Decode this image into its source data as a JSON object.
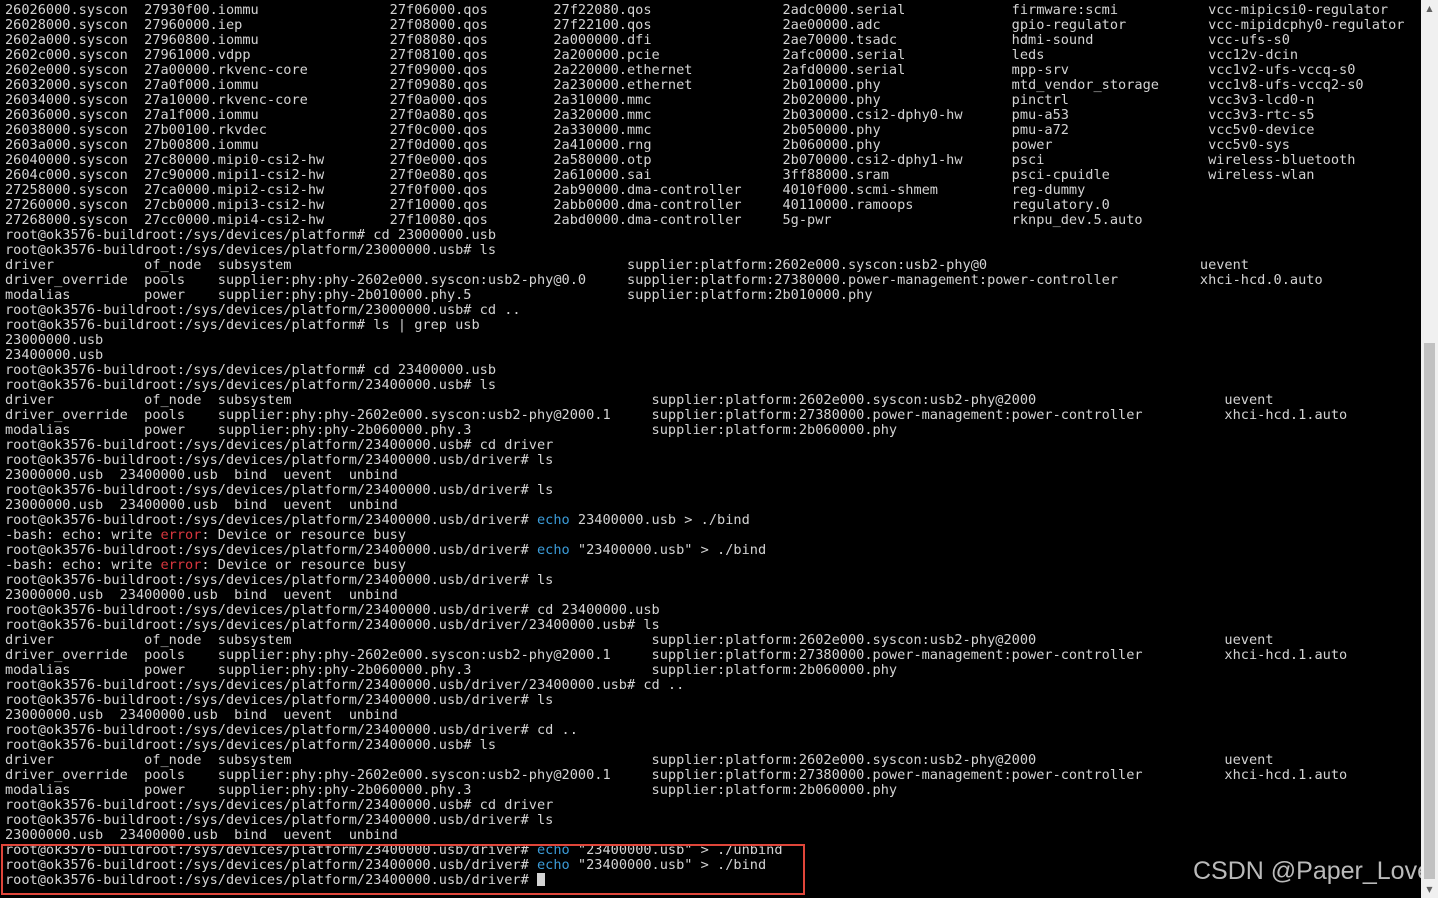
{
  "terminal": {
    "lines": [
      "26026000.syscon  27930f00.iommu                27f06000.qos        27f22080.qos                2adc0000.serial             firmware:scmi           vcc-mipicsi0-regulator",
      "26028000.syscon  27960000.iep                  27f08000.qos        27f22100.qos                2ae00000.adc                gpio-regulator          vcc-mipidcphy0-regulator",
      "2602a000.syscon  27960800.iommu                27f08080.qos        2a000000.dfi                2ae70000.tsadc              hdmi-sound              vcc-ufs-s0",
      "2602c000.syscon  27961000.vdpp                 27f08100.qos        2a200000.pcie               2afc0000.serial             leds                    vcc12v-dcin",
      "2602e000.syscon  27a00000.rkvenc-core          27f09000.qos        2a220000.ethernet           2afd0000.serial             mpp-srv                 vcc1v2-ufs-vccq-s0",
      "26032000.syscon  27a0f000.iommu                27f09080.qos        2a230000.ethernet           2b010000.phy                mtd_vendor_storage      vcc1v8-ufs-vccq2-s0",
      "26034000.syscon  27a10000.rkvenc-core          27f0a000.qos        2a310000.mmc                2b020000.phy                pinctrl                 vcc3v3-lcd0-n",
      "26036000.syscon  27a1f000.iommu                27f0a080.qos        2a320000.mmc                2b030000.csi2-dphy0-hw      pmu-a53                 vcc3v3-rtc-s5",
      "26038000.syscon  27b00100.rkvdec               27f0c000.qos        2a330000.mmc                2b050000.phy                pmu-a72                 vcc5v0-device",
      "2603a000.syscon  27b00800.iommu                27f0d000.qos        2a410000.rng                2b060000.phy                power                   vcc5v0-sys",
      "26040000.syscon  27c80000.mipi0-csi2-hw        27f0e000.qos        2a580000.otp                2b070000.csi2-dphy1-hw      psci                    wireless-bluetooth",
      "2604c000.syscon  27c90000.mipi1-csi2-hw        27f0e080.qos        2a610000.sai                3ff88000.sram               psci-cpuidle            wireless-wlan",
      "27258000.syscon  27ca0000.mipi2-csi2-hw        27f0f000.qos        2ab90000.dma-controller     4010f000.scmi-shmem         reg-dummy",
      "27260000.syscon  27cb0000.mipi3-csi2-hw        27f10000.qos        2abb0000.dma-controller     40110000.ramoops            regulatory.0",
      "27268000.syscon  27cc0000.mipi4-csi2-hw        27f10080.qos        2abd0000.dma-controller     5g-pwr                      rknpu_dev.5.auto",
      "root@ok3576-buildroot:/sys/devices/platform# cd 23000000.usb",
      "root@ok3576-buildroot:/sys/devices/platform/23000000.usb# ls",
      "driver           of_node  subsystem                                         supplier:platform:2602e000.syscon:usb2-phy@0                          uevent",
      "driver_override  pools    supplier:phy:phy-2602e000.syscon:usb2-phy@0.0     supplier:platform:27380000.power-management:power-controller          xhci-hcd.0.auto",
      "modalias         power    supplier:phy:phy-2b010000.phy.5                   supplier:platform:2b010000.phy",
      "root@ok3576-buildroot:/sys/devices/platform/23000000.usb# cd ..",
      "root@ok3576-buildroot:/sys/devices/platform# ls | grep usb",
      "23000000.usb",
      "23400000.usb",
      "root@ok3576-buildroot:/sys/devices/platform# cd 23400000.usb",
      "root@ok3576-buildroot:/sys/devices/platform/23400000.usb# ls",
      "driver           of_node  subsystem                                            supplier:platform:2602e000.syscon:usb2-phy@2000                       uevent",
      "driver_override  pools    supplier:phy:phy-2602e000.syscon:usb2-phy@2000.1     supplier:platform:27380000.power-management:power-controller          xhci-hcd.1.auto",
      "modalias         power    supplier:phy:phy-2b060000.phy.3                      supplier:platform:2b060000.phy",
      "root@ok3576-buildroot:/sys/devices/platform/23400000.usb# cd driver",
      "root@ok3576-buildroot:/sys/devices/platform/23400000.usb/driver# ls",
      "23000000.usb  23400000.usb  bind  uevent  unbind",
      "root@ok3576-buildroot:/sys/devices/platform/23400000.usb/driver# ls",
      "23000000.usb  23400000.usb  bind  uevent  unbind",
      "root@ok3576-buildroot:/sys/devices/platform/23400000.usb/driver# echo 23400000.usb > ./bind",
      "-bash: echo: write error: Device or resource busy",
      "root@ok3576-buildroot:/sys/devices/platform/23400000.usb/driver# echo \"23400000.usb\" > ./bind",
      "-bash: echo: write error: Device or resource busy",
      "root@ok3576-buildroot:/sys/devices/platform/23400000.usb/driver# ls",
      "23000000.usb  23400000.usb  bind  uevent  unbind",
      "root@ok3576-buildroot:/sys/devices/platform/23400000.usb/driver# cd 23400000.usb",
      "root@ok3576-buildroot:/sys/devices/platform/23400000.usb/driver/23400000.usb# ls",
      "driver           of_node  subsystem                                            supplier:platform:2602e000.syscon:usb2-phy@2000                       uevent",
      "driver_override  pools    supplier:phy:phy-2602e000.syscon:usb2-phy@2000.1     supplier:platform:27380000.power-management:power-controller          xhci-hcd.1.auto",
      "modalias         power    supplier:phy:phy-2b060000.phy.3                      supplier:platform:2b060000.phy",
      "root@ok3576-buildroot:/sys/devices/platform/23400000.usb/driver/23400000.usb# cd ..",
      "root@ok3576-buildroot:/sys/devices/platform/23400000.usb/driver# ls",
      "23000000.usb  23400000.usb  bind  uevent  unbind",
      "root@ok3576-buildroot:/sys/devices/platform/23400000.usb/driver# cd ..",
      "root@ok3576-buildroot:/sys/devices/platform/23400000.usb# ls",
      "driver           of_node  subsystem                                            supplier:platform:2602e000.syscon:usb2-phy@2000                       uevent",
      "driver_override  pools    supplier:phy:phy-2602e000.syscon:usb2-phy@2000.1     supplier:platform:27380000.power-management:power-controller          xhci-hcd.1.auto",
      "modalias         power    supplier:phy:phy-2b060000.phy.3                      supplier:platform:2b060000.phy",
      "root@ok3576-buildroot:/sys/devices/platform/23400000.usb# cd driver",
      "root@ok3576-buildroot:/sys/devices/platform/23400000.usb/driver# ls",
      "23000000.usb  23400000.usb  bind  uevent  unbind",
      "root@ok3576-buildroot:/sys/devices/platform/23400000.usb/driver# echo \"23400000.usb\" > ./unbind",
      "root@ok3576-buildroot:/sys/devices/platform/23400000.usb/driver# echo \"23400000.usb\" > ./bind",
      "root@ok3576-buildroot:/sys/devices/platform/23400000.usb/driver# "
    ]
  },
  "colors": {
    "background": "#000000",
    "text": "#d4d4d4",
    "command_keyword": "#3b9cd9",
    "error_keyword": "#d9363e",
    "highlight_border": "#e0463a"
  },
  "watermark": {
    "text": "CSDN @Paper_Love"
  },
  "scrollbar": {
    "up_icon": "triangle-up",
    "down_icon": "triangle-down"
  }
}
